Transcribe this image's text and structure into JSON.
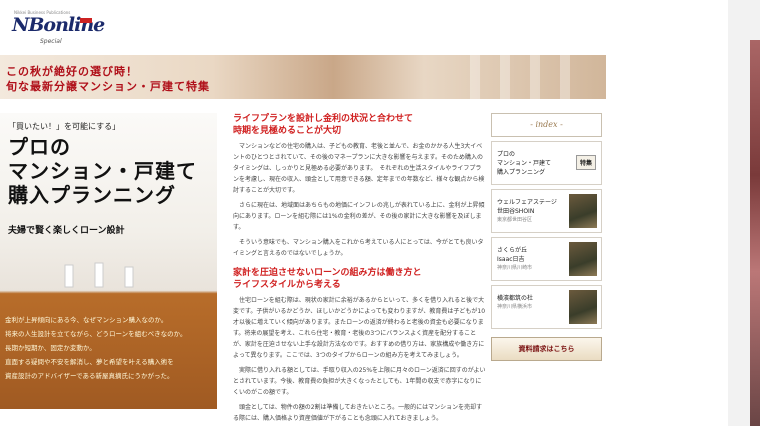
{
  "logo": {
    "toptext": "Nikkei Business Publications",
    "brand": "NBonline",
    "sub": "Special"
  },
  "banner": {
    "line1": "この秋が絶好の選び時！",
    "line2": "旬な最新分譲マンション・戸建て特集"
  },
  "hero": {
    "kicker": "「買いたい！」を可能にする」",
    "headline": [
      "プロの",
      "マンション・戸建て",
      "購入プランニング"
    ],
    "subhead": "夫婦で賢く楽しくローン設計",
    "blurb": [
      "金利が上昇傾向にある今、なぜマンション購入なのか。",
      "将来の人生設計を立てながら、どうローンを組むべきなのか。",
      "長期か短期か、固定か変動か。",
      "直面する疑問や不安を解消し、夢と希望を叶える購入術を",
      "資産設計のアドバイザーである新屋真摘氏にうかがった。"
    ]
  },
  "sections": [
    {
      "title": [
        "ライフプランを設計し金利の状況と合わせて",
        "時期を見極めることが大切"
      ],
      "paragraphs": [
        "マンションなどの住宅の購入は、子どもの教育、老後と並んで、お金のかかる人生3大イベントのひとつとされていて、その後のマネープランに大きな影響を与えます。そのため購入のタイミングは、しっかりと見極める必要があります。　それぞれの生活スタイルやライフプランを考慮し、現在の収入、頭金として用意できる額、定年までの年数など、様々な観点から検討することが大切です。",
        "さらに現在は、地域面はあちらもの地価にインフレの兆しが表れている上に、金利が上昇傾向にあります。ローンを組む際には1%の金利の差が、その後の家計に大きな影響を及ぼします。",
        "そういう意味でも、マンション購入をこれから考えている人にとっては、今がとても良いタイミングと言えるのではないでしょうか。"
      ]
    },
    {
      "title": [
        "家計を圧迫させないローンの組み方は働き方と",
        "ライフスタイルから考える"
      ],
      "paragraphs": [
        "住宅ローンを組む際は、現状の家計に余裕があるからといって、多くを借り入れると後で大変です。子供がいるかどうか、ほしいかどうかによっても変わりますが、教育費は子どもが10才以後に増えていく傾向があります。またローンの返済が終わると老後の資金も必要になります。将来の展望を考え、これら住宅・教育・老後の3つにバランスよく資産を配分することが、家計を圧迫させない上手な設計方法なのです。おすすめの借り方は、家族構成や働き方によって異なります。ここでは、3つのタイプからローンの組み方を考えてみましょう。",
        "実際に借り入れる額としては、手取り収入の25%を上限に月々のローン返済に回すのがよいとされています。今後、教育費の負担が大きくなったとしても、1年間の収支で赤字になりにくいのがこの額です。",
        "頭金としては、物件の額の2割は準備しておきたいところ。一般的にはマンションを売却する際には、購入価格より資産価値が下がることも念頭に入れておきましょう。"
      ]
    }
  ],
  "index": {
    "title": "- index -",
    "items": [
      {
        "name": "プロの\nマンション・戸建て\n購入プランニング",
        "place": "",
        "badge": "特集"
      },
      {
        "name": "ウェルフェアステージ\n世田谷SHOIN",
        "place": "東京都世田谷区",
        "badge": ""
      },
      {
        "name": "さくらが丘\nIsaac日吉",
        "place": "神奈川県川崎市",
        "badge": ""
      },
      {
        "name": "横濱都筑の杜",
        "place": "神奈川県横浜市",
        "badge": ""
      }
    ],
    "request": "資料請求はこちら"
  }
}
